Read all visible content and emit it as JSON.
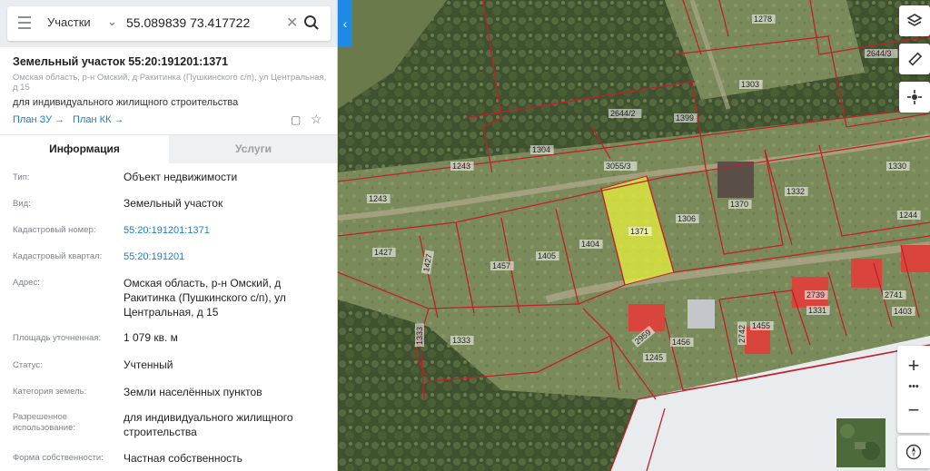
{
  "search": {
    "type_label": "Участки",
    "query": "55.089839 73.417722"
  },
  "object": {
    "title": "Земельный участок 55:20:191201:1371",
    "address_short": "Омская область, р-н Омский, д Ракитинка (Пушкинского с/п), ул Центральная, д 15",
    "purpose": "для индивидуального жилищного строительства",
    "link_zu": "План ЗУ →",
    "link_kk": "План КК →"
  },
  "tabs": {
    "info": "Информация",
    "services": "Услуги"
  },
  "info_rows": [
    {
      "key": "Тип:",
      "value": "Объект недвижимости"
    },
    {
      "key": "Вид:",
      "value": "Земельный участок"
    },
    {
      "key": "Кадастровый номер:",
      "value": "55:20:191201:1371"
    },
    {
      "key": "Кадастровый квартал:",
      "value": "55:20:191201"
    },
    {
      "key": "Адрес:",
      "value": "Омская область, р-н Омский, д Ракитинка (Пушкинского с/п), ул Центральная, д 15"
    },
    {
      "key": "Площадь уточненная:",
      "value": "1 079 кв. м"
    },
    {
      "key": "Статус:",
      "value": "Учтенный"
    },
    {
      "key": "Категория земель:",
      "value": "Земли населённых пунктов"
    },
    {
      "key": "Разрешенное использование:",
      "value": "для индивидуального жилищного строительства"
    },
    {
      "key": "Форма собственности:",
      "value": "Частная собственность"
    }
  ],
  "map_labels": [
    "1278",
    "2644/3",
    "1303",
    "2644/2",
    "1399",
    "1304",
    "1243",
    "3055/3",
    "1330",
    "1243",
    "1332",
    "1370",
    "1306",
    "1244",
    "1427",
    "1457",
    "1405",
    "1404",
    "1371",
    "1427",
    "2741",
    "1403",
    "2739",
    "1331",
    "1455",
    "1333",
    "1333",
    "1456",
    "2742",
    "2959",
    "1245"
  ],
  "colors": {
    "accent": "#1e88e5",
    "plot_border": "#c0202a",
    "selected_plot": "#e6f03c"
  },
  "icons": [
    "menu-icon",
    "chevron-down-icon",
    "close-icon",
    "search-icon",
    "document-icon",
    "star-icon",
    "layers-icon",
    "ruler-icon",
    "locate-icon",
    "compass-icon"
  ]
}
